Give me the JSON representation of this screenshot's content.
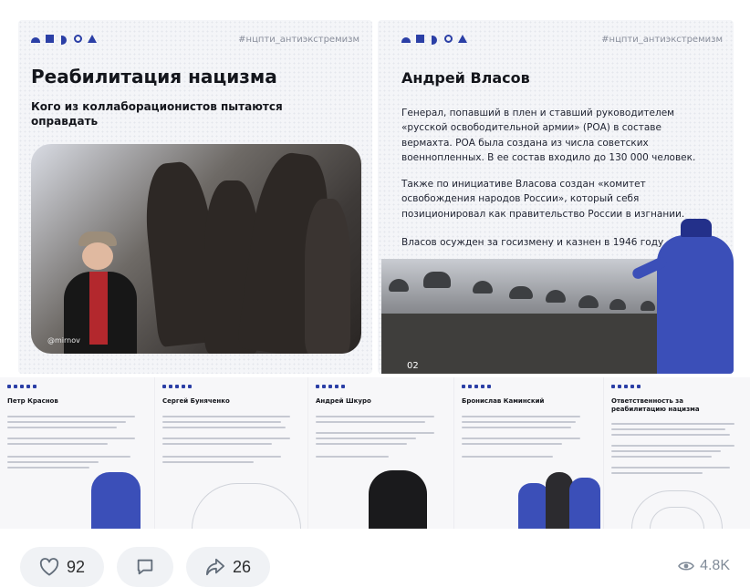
{
  "left_slide": {
    "hashtag": "#нцпти_антиэкстремизм",
    "title": "Реабилитация нацизма",
    "subtitle": "Кого из коллаборационистов пытаются оправдать",
    "photo_credit": "@mirnov"
  },
  "right_slide": {
    "hashtag": "#нцпти_антиэкстремизм",
    "title": "Андрей Власов",
    "paragraphs": [
      "Генерал, попавший в плен и ставший руководителем «русской освободительной армии» (РОА) в составе вермахта. РОА была создана из числа советских военнопленных. В ее состав входило до 130 000 человек.",
      "Также по инициативе Власова создан «комитет освобождения народов России», который себя позиционировал как правительство России в изгнании.",
      "Власов осужден за госизмену и казнен в 1946 году."
    ],
    "page_number": "02"
  },
  "thumbnails": [
    {
      "title": "Петр Краснов"
    },
    {
      "title": "Сергей Буняченко"
    },
    {
      "title": "Андрей Шкуро"
    },
    {
      "title": "Бронислав Каминский"
    },
    {
      "title": "Ответственность за реабилитацию нацизма"
    }
  ],
  "actions": {
    "likes": "92",
    "shares": "26",
    "views": "4.8K"
  },
  "colors": {
    "brand_blue": "#2b3fa6",
    "officer_blue": "#3b4fb8",
    "pill_bg": "#f0f2f5",
    "muted": "#818c99"
  },
  "icons": [
    "heart-icon",
    "comment-icon",
    "share-icon",
    "eye-icon"
  ]
}
